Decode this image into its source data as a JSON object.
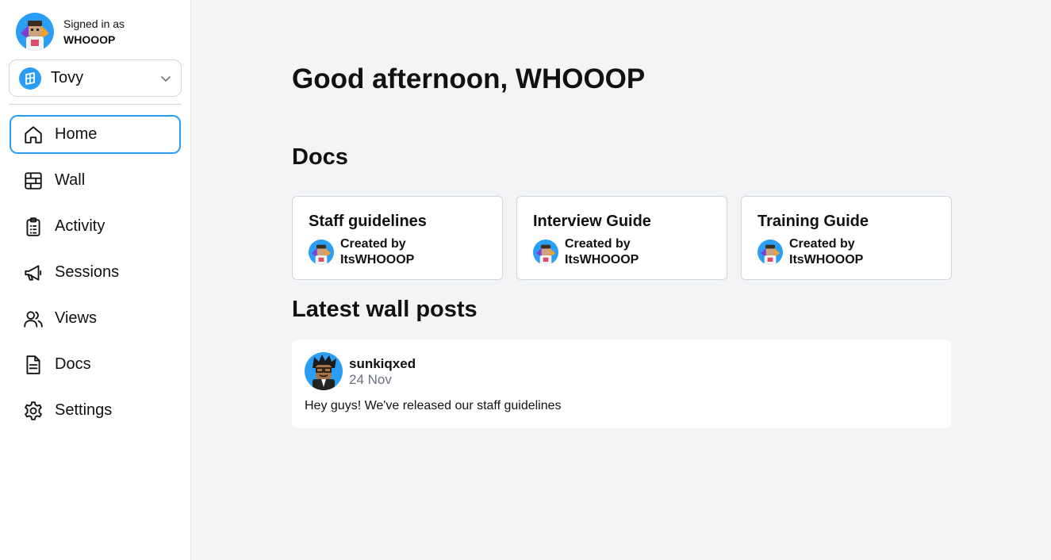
{
  "user": {
    "signed_in_label": "Signed in as",
    "username": "WHOOOP"
  },
  "workspace": {
    "name": "Tovy",
    "logo_color": "#2a9df4"
  },
  "nav": {
    "items": [
      {
        "label": "Home",
        "icon": "home-icon",
        "active": true
      },
      {
        "label": "Wall",
        "icon": "wall-icon"
      },
      {
        "label": "Activity",
        "icon": "clipboard-icon"
      },
      {
        "label": "Sessions",
        "icon": "megaphone-icon"
      },
      {
        "label": "Views",
        "icon": "users-icon"
      },
      {
        "label": "Docs",
        "icon": "document-icon"
      },
      {
        "label": "Settings",
        "icon": "gear-icon"
      }
    ]
  },
  "main": {
    "greeting": "Good afternoon, WHOOOP",
    "docs_title": "Docs",
    "docs": [
      {
        "title": "Staff guidelines",
        "created_by_label": "Created by",
        "author": "ItsWHOOOP"
      },
      {
        "title": "Interview Guide",
        "created_by_label": "Created by",
        "author": "ItsWHOOOP"
      },
      {
        "title": "Training Guide",
        "created_by_label": "Created by",
        "author": "ItsWHOOOP"
      }
    ],
    "wall_title": "Latest wall posts",
    "posts": [
      {
        "author": "sunkiqxed",
        "date": "24 Nov",
        "body": "Hey guys! We've released our staff guidelines"
      }
    ]
  },
  "colors": {
    "accent": "#2a9df4",
    "background": "#f3f4f6"
  }
}
